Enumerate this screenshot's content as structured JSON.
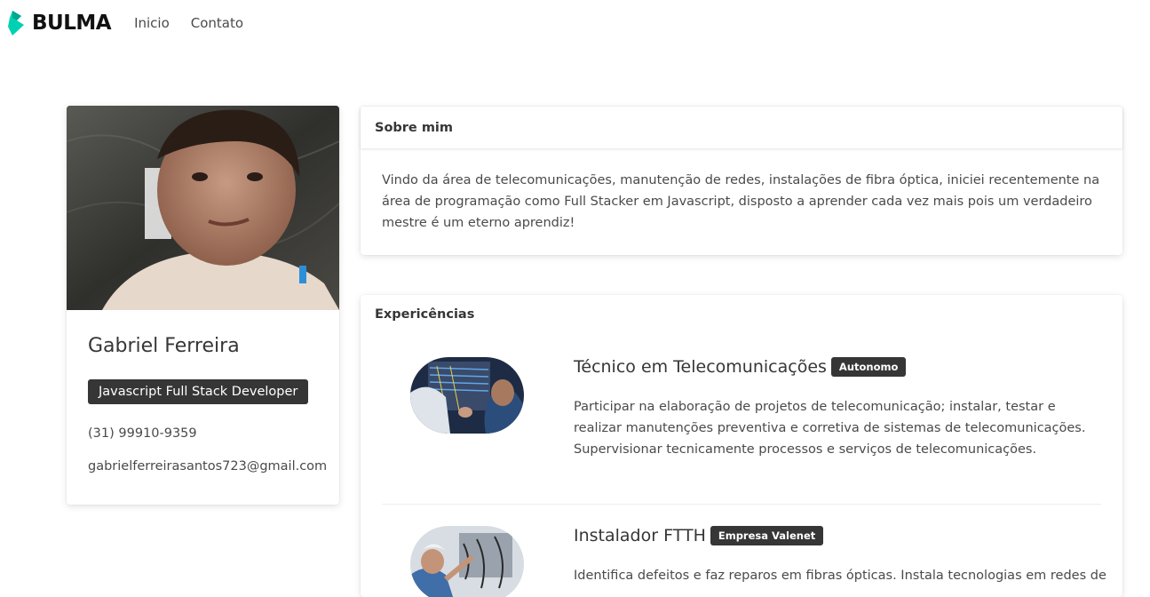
{
  "navbar": {
    "brand": "BULMA",
    "links": [
      "Inicio",
      "Contato"
    ]
  },
  "profile": {
    "name": "Gabriel Ferreira",
    "role": "Javascript Full Stack Developer",
    "phone": "(31) 99910-9359",
    "email": "gabrielferreirasantos723@gmail.com"
  },
  "about": {
    "title": "Sobre mim",
    "text": "Vindo da área de telecomunicações, manutenção de redes, instalações de fibra óptica, iniciei recentemente na área de programação como Full Stacker em Javascript, disposto a aprender cada vez mais pois um verdadeiro mestre é um eterno aprendiz!"
  },
  "experiences": {
    "title": "Expericências",
    "items": [
      {
        "role": "Técnico em Telecomunicações",
        "company": "Autonomo",
        "description": "Participar na elaboração de projetos de telecomunicação; instalar, testar e realizar manutenções preventiva e corretiva de sistemas de telecomunicações. Supervisionar tecnicamente processos e serviços de telecomunicações."
      },
      {
        "role": "Instalador FTTH",
        "company": "Empresa Valenet",
        "description": "Identifica defeitos e faz reparos em fibras ópticas. Instala tecnologias em redes de"
      }
    ]
  },
  "colors": {
    "brand": "#00d1b2",
    "tag_dark": "#363636",
    "text": "#4a4a4a"
  }
}
